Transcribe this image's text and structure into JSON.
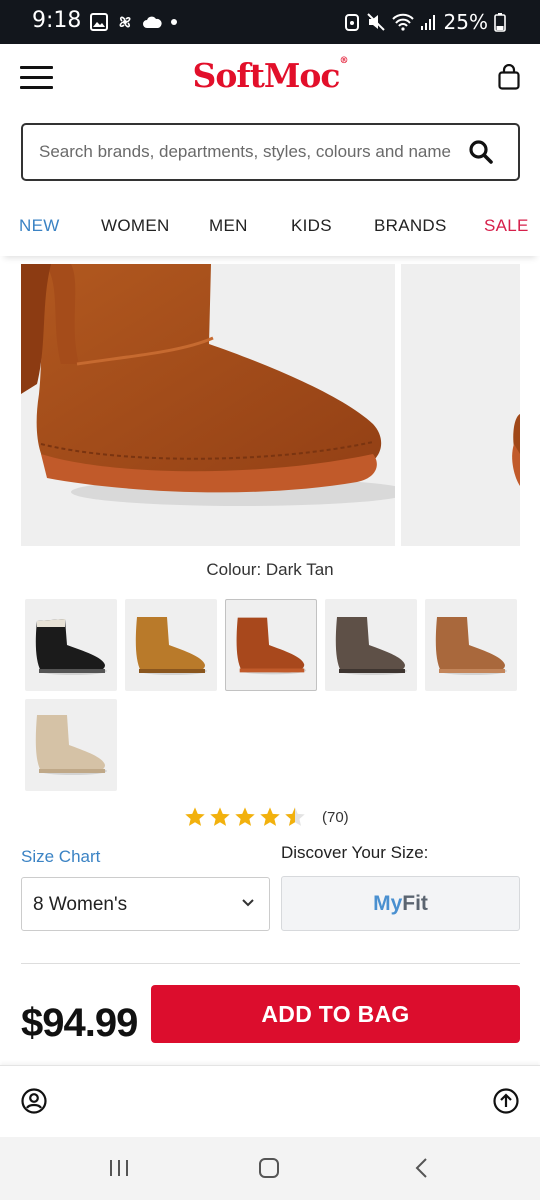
{
  "status_bar": {
    "time": "9:18",
    "battery": "25%",
    "icons": [
      "gallery-icon",
      "fan-icon",
      "cloud-icon",
      "dot-icon",
      "alarm-icon",
      "mute-icon",
      "wifi-icon",
      "signal-icon",
      "battery-icon"
    ]
  },
  "header": {
    "logo_text": "SoftMoc",
    "logo_mark": "®",
    "brand_color": "#e20f2a",
    "icons": [
      "hamburger-menu-icon",
      "shopping-bag-icon"
    ]
  },
  "search": {
    "placeholder": "Search brands, departments, styles, colours and name",
    "icon": "search-icon"
  },
  "nav": {
    "items": [
      {
        "label": "NEW",
        "color": "#3b83c4"
      },
      {
        "label": "WOMEN",
        "color": "#222222"
      },
      {
        "label": "MEN",
        "color": "#222222"
      },
      {
        "label": "KIDS",
        "color": "#222222"
      },
      {
        "label": "BRANDS",
        "color": "#222222"
      },
      {
        "label": "SALE",
        "color": "#d6204b"
      }
    ]
  },
  "product": {
    "colour_label": "Colour: Dark Tan",
    "swatches": [
      {
        "name": "Black",
        "color": "#1b1b1b",
        "selected": false
      },
      {
        "name": "Chestnut",
        "color": "#b97a2a",
        "selected": false
      },
      {
        "name": "Dark Tan",
        "color": "#a8481c",
        "selected": true
      },
      {
        "name": "Grey Brown",
        "color": "#5e5047",
        "selected": false
      },
      {
        "name": "Tan",
        "color": "#a9683c",
        "selected": false
      },
      {
        "name": "Sand",
        "color": "#d5c2a6",
        "selected": false
      }
    ],
    "rating": 4.5,
    "rating_count": "(70)",
    "star_color": "#f2b10d",
    "size_chart_label": "Size Chart",
    "discover_label": "Discover Your Size:",
    "selected_size": "8 Women's",
    "myfit_my": "My",
    "myfit_fit": "Fit",
    "price": "$94.99",
    "add_to_bag_label": "ADD TO BAG",
    "add_to_bag_color": "#dc0d2d"
  },
  "bottom_bar": {
    "icons": [
      "account-icon",
      "scroll-to-top-icon"
    ]
  },
  "system_nav": {
    "icons": [
      "recent-apps-icon",
      "home-icon",
      "back-icon"
    ]
  }
}
